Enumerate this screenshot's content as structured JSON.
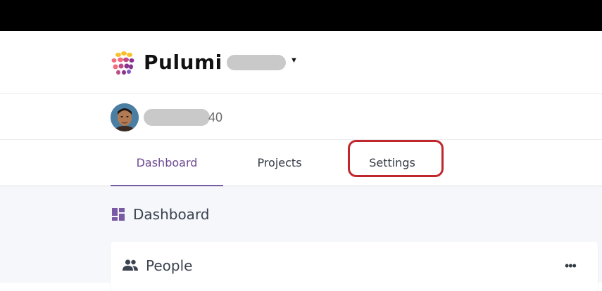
{
  "header": {
    "brand": "Pulumi",
    "org_switcher": {
      "label": "",
      "caret": "▼"
    }
  },
  "user": {
    "name_suffix": "40"
  },
  "tabs": [
    {
      "label": "Dashboard",
      "active": true
    },
    {
      "label": "Projects",
      "active": false
    },
    {
      "label": "Settings",
      "active": false
    }
  ],
  "dashboard": {
    "title": "Dashboard",
    "card": {
      "title": "People",
      "more": "•••"
    }
  },
  "colors": {
    "accent_purple": "#7a5aa5",
    "highlight_red": "#c0272d",
    "top_bar": "#000000"
  },
  "icons": [
    "pulumi-logo-icon",
    "caret-down-icon",
    "avatar",
    "dashboard-grid-icon",
    "people-icon",
    "more-horizontal-icon"
  ]
}
